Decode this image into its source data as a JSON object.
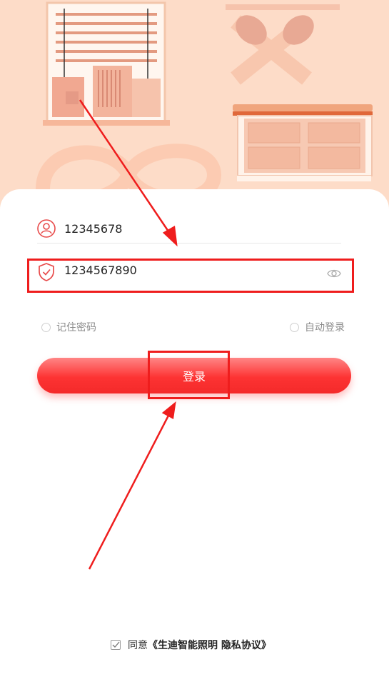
{
  "login": {
    "username": "12345678",
    "password": "1234567890",
    "remember_label": "记住密码",
    "auto_login_label": "自动登录",
    "login_button": "登录"
  },
  "agreement": {
    "prefix": "同意",
    "link": "《生迪智能照明 隐私协议》"
  },
  "colors": {
    "accent": "#fd3333",
    "hero_bg": "#fddcc8",
    "annotation": "#ef1d1d"
  }
}
